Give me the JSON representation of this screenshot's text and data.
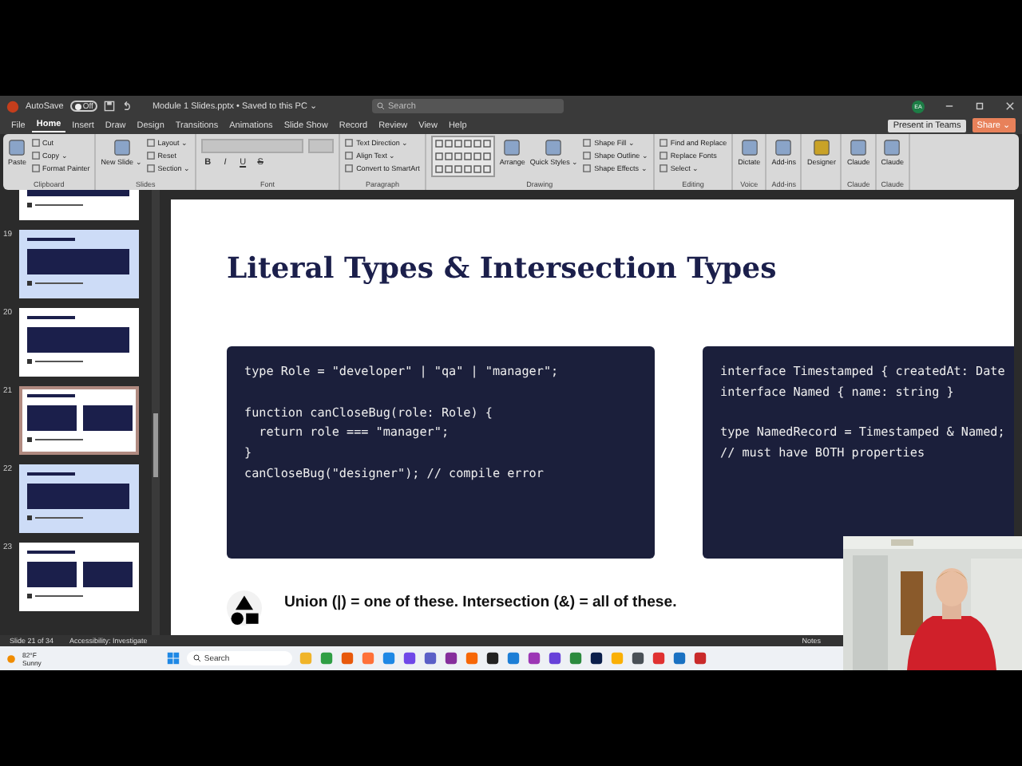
{
  "title_bar": {
    "autosave_label": "AutoSave",
    "autosave_on": false,
    "autosave_state": "Off",
    "document_title": "Module 1 Slides.pptx • Saved to this PC ⌄",
    "search_placeholder": "Search",
    "account_initials": "EA"
  },
  "menu_tabs": [
    {
      "label": "File",
      "selected": false
    },
    {
      "label": "Home",
      "selected": true
    },
    {
      "label": "Insert",
      "selected": false
    },
    {
      "label": "Draw",
      "selected": false
    },
    {
      "label": "Design",
      "selected": false
    },
    {
      "label": "Transitions",
      "selected": false
    },
    {
      "label": "Animations",
      "selected": false
    },
    {
      "label": "Slide Show",
      "selected": false
    },
    {
      "label": "Record",
      "selected": false
    },
    {
      "label": "Review",
      "selected": false
    },
    {
      "label": "View",
      "selected": false
    },
    {
      "label": "Help",
      "selected": false
    }
  ],
  "header_buttons": [
    {
      "label": "Present in Teams",
      "kind": "plain"
    },
    {
      "label": "Share ⌄",
      "kind": "accent"
    }
  ],
  "ribbon_groups": [
    {
      "label": "Clipboard",
      "items": [
        {
          "kind": "large",
          "label": "Paste"
        },
        {
          "kind": "small",
          "label": "Cut"
        },
        {
          "kind": "small",
          "label": "Copy ⌄"
        },
        {
          "kind": "small",
          "label": "Format Painter"
        }
      ]
    },
    {
      "label": "Slides",
      "items": [
        {
          "kind": "large",
          "label": "New Slide ⌄"
        },
        {
          "kind": "small",
          "label": "Layout ⌄"
        },
        {
          "kind": "small",
          "label": "Reset"
        },
        {
          "kind": "small",
          "label": "Section ⌄"
        }
      ]
    },
    {
      "label": "Font",
      "items": [
        {
          "kind": "format",
          "label": "B"
        },
        {
          "kind": "format",
          "label": "I"
        },
        {
          "kind": "format",
          "label": "U"
        },
        {
          "kind": "format",
          "label": "S"
        }
      ]
    },
    {
      "label": "Paragraph",
      "items": [
        {
          "kind": "small",
          "label": "Text Direction ⌄"
        },
        {
          "kind": "small",
          "label": "Align Text ⌄"
        },
        {
          "kind": "small",
          "label": "Convert to SmartArt"
        }
      ]
    },
    {
      "label": "Drawing",
      "items": [
        {
          "kind": "gallery"
        },
        {
          "kind": "large",
          "label": "Arrange"
        },
        {
          "kind": "large",
          "label": "Quick Styles ⌄"
        },
        {
          "kind": "small",
          "label": "Shape Fill ⌄"
        },
        {
          "kind": "small",
          "label": "Shape Outline ⌄"
        },
        {
          "kind": "small",
          "label": "Shape Effects ⌄"
        }
      ]
    },
    {
      "label": "Editing",
      "items": [
        {
          "kind": "small",
          "label": "Find and Replace"
        },
        {
          "kind": "small",
          "label": "Replace Fonts"
        },
        {
          "kind": "small",
          "label": "Select ⌄"
        }
      ]
    },
    {
      "label": "Voice",
      "items": [
        {
          "kind": "large",
          "label": "Dictate"
        }
      ]
    },
    {
      "label": "Add-ins",
      "items": [
        {
          "kind": "large",
          "label": "Add-ins"
        }
      ]
    },
    {
      "items": [
        {
          "kind": "large",
          "label": "Designer"
        }
      ]
    },
    {
      "label": "Claude",
      "items": [
        {
          "kind": "large",
          "label": "Claude"
        }
      ]
    },
    {
      "label": "Claude",
      "items": [
        {
          "kind": "large",
          "label": "Claude"
        }
      ]
    }
  ],
  "thumbnails": [
    {
      "selected": false,
      "tinted": false,
      "kind": "one_block"
    },
    {
      "number": "19",
      "selected": false,
      "tinted": true,
      "kind": "one_block"
    },
    {
      "number": "20",
      "selected": false,
      "tinted": false,
      "kind": "one_block"
    },
    {
      "number": "21",
      "selected": true,
      "tinted": false,
      "kind": "two_blocks"
    },
    {
      "number": "22",
      "selected": false,
      "tinted": true,
      "kind": "one_block"
    },
    {
      "number": "23",
      "selected": false,
      "tinted": false,
      "kind": "two_blocks"
    }
  ],
  "slide": {
    "title": "Literal Types & Intersection Types",
    "code_blocks": [
      {
        "paragraphs": [
          [
            "type Role = \"developer\" | \"qa\" | \"manager\";"
          ],
          [
            "function canCloseBug(role: Role) {",
            "  return role === \"manager\";",
            "}",
            "canCloseBug(\"designer\"); // compile error"
          ]
        ]
      },
      {
        "paragraphs": [
          [
            "interface Timestamped { createdAt: Date",
            "interface Named { name: string }"
          ],
          [
            "type NamedRecord = Timestamped & Named;",
            "// must have BOTH properties"
          ]
        ]
      }
    ],
    "bullet": "Union (|) = one of these. Intersection (&) = all of these."
  },
  "status_bar": {
    "slide_count": "Slide 21 of 34",
    "accessibility": "Accessibility: Investigate",
    "notes": "Notes"
  },
  "taskbar": {
    "temperature": "82°F",
    "weather": "Sunny",
    "search_placeholder": "Search",
    "apps": [
      {
        "color": "#f0b429"
      },
      {
        "color": "#2f9e44"
      },
      {
        "color": "#e8590c"
      },
      {
        "color": "#ff7139"
      },
      {
        "color": "#1e88e5"
      },
      {
        "color": "#7048e8"
      },
      {
        "color": "#5b5fc7"
      },
      {
        "color": "#862e9c"
      },
      {
        "color": "#f76707"
      },
      {
        "color": "#222222"
      },
      {
        "color": "#1c7ed6"
      },
      {
        "color": "#9c36b5"
      },
      {
        "color": "#6741d9"
      },
      {
        "color": "#2b8a3e"
      },
      {
        "color": "#0b1f4b"
      },
      {
        "color": "#fab005"
      },
      {
        "color": "#495057"
      },
      {
        "color": "#e03131"
      },
      {
        "color": "#1971c2"
      },
      {
        "color": "#c92a2a"
      }
    ]
  }
}
